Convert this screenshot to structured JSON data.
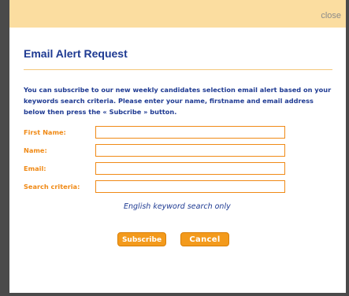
{
  "topbar": {
    "close_label": "close"
  },
  "dialog": {
    "title": "Email Alert Request",
    "intro": "You can subscribe to our new weekly candidates selection email alert based on your keywords search criteria. Please enter your name, firstname and email address below then press the « Subcribe » button.",
    "hint": "English keyword search only"
  },
  "form": {
    "fields": [
      {
        "label": "First Name:",
        "value": ""
      },
      {
        "label": "Name:",
        "value": ""
      },
      {
        "label": "Email:",
        "value": ""
      },
      {
        "label": "Search criteria:",
        "value": ""
      }
    ]
  },
  "buttons": {
    "subscribe_label": "Subscribe",
    "cancel_label": "Cancel"
  },
  "colors": {
    "topbar_bg": "#fbdda0",
    "title_blue": "#1e3a92",
    "label_orange": "#f08a16",
    "button_orange": "#f39a1c",
    "outer_frame": "#4a4a4a"
  }
}
